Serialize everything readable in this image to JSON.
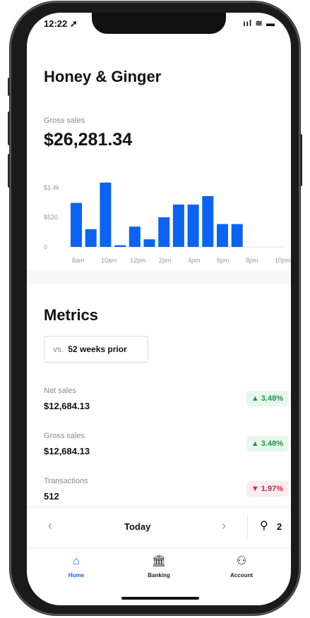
{
  "status_bar": {
    "time": "12:22 ➚",
    "icons": "ııl ≋ ▬"
  },
  "business_name": "Honey & Ginger",
  "gross_sales": {
    "label": "Gross sales",
    "value": "$26,281.34"
  },
  "chart_data": {
    "type": "bar",
    "y_tick_labels": [
      "$1.4k",
      "$520",
      "0"
    ],
    "x_tick_labels": [
      "8am",
      "10am",
      "12pm",
      "2pm",
      "4pm",
      "6pm",
      "8pm",
      "10pm"
    ],
    "values": [
      520,
      210,
      760,
      20,
      240,
      90,
      350,
      500,
      500,
      600,
      270,
      270
    ],
    "ylim": [
      0,
      800
    ],
    "color": "#0a63f2",
    "grid": false
  },
  "metrics": {
    "title": "Metrics",
    "comparison": {
      "prefix": "vs.",
      "period": "52 weeks prior"
    },
    "items": [
      {
        "label": "Net sales",
        "value": "$12,684.13",
        "change": "▲ 3.48%",
        "direction": "up"
      },
      {
        "label": "Gross sales",
        "value": "$12,684.13",
        "change": "▲ 3.48%",
        "direction": "up"
      },
      {
        "label": "Transactions",
        "value": "512",
        "change": "▼ 1.97%",
        "direction": "down"
      }
    ]
  },
  "date_nav": {
    "prev": "‹",
    "label": "Today",
    "next": "›",
    "location_icon": "⚲",
    "location_count": "2"
  },
  "tabs": [
    {
      "label": "Home",
      "icon": "⌂",
      "icon_name": "home-icon",
      "active": true
    },
    {
      "label": "Banking",
      "icon": "🏛",
      "icon_name": "bank-icon",
      "active": false
    },
    {
      "label": "Account",
      "icon": "⚇",
      "icon_name": "account-icon",
      "active": false
    }
  ],
  "colors": {
    "accent": "#0a63f2",
    "positive": "#23934a",
    "negative": "#d1224a"
  }
}
